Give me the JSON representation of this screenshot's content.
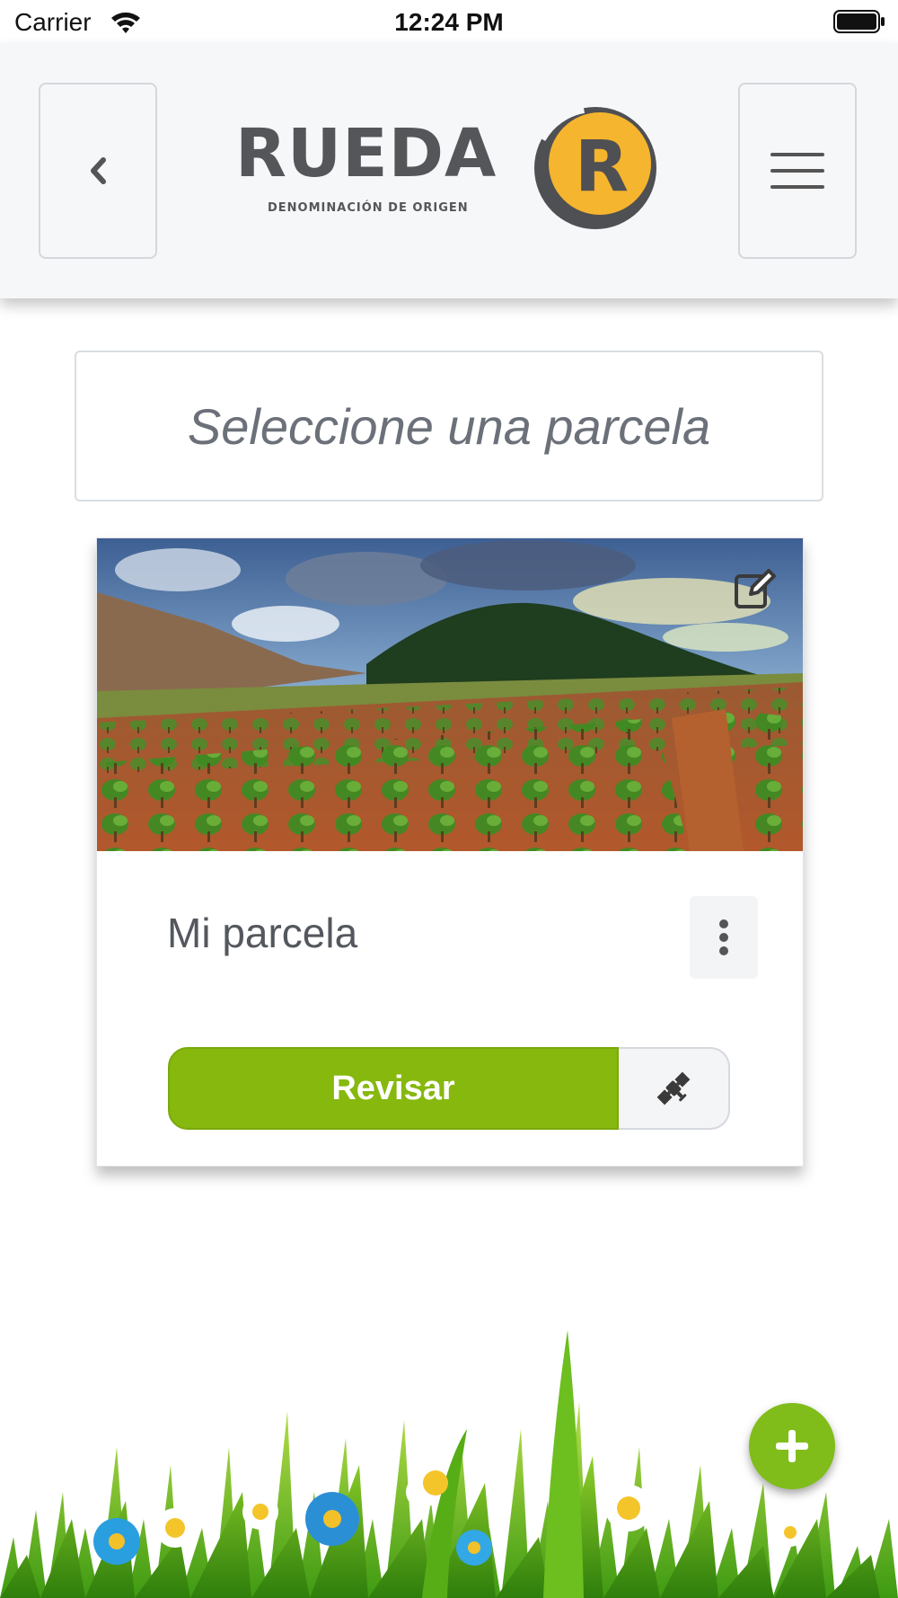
{
  "status_bar": {
    "carrier": "Carrier",
    "time": "12:24 PM",
    "wifi_icon": "wifi-icon",
    "battery_icon": "battery-full-icon"
  },
  "header": {
    "back_icon": "chevron-left-icon",
    "menu_icon": "hamburger-menu-icon",
    "logo": {
      "wordmark": "RUEDA",
      "tagline": "DENOMINACIÓN DE ORIGEN",
      "mark_letter": "R",
      "colors": {
        "text": "#555659",
        "mark_ring": "#4f5054",
        "mark_fill": "#f6b52e"
      }
    }
  },
  "page": {
    "title": "Seleccione una parcela"
  },
  "parcel_card": {
    "name": "Mi parcela",
    "edit_icon": "edit-icon",
    "options_icon": "vertical-dots-icon",
    "review_button": "Revisar",
    "satellite_icon": "satellite-icon"
  },
  "fab": {
    "icon": "plus-icon"
  },
  "colors": {
    "primary_green": "#86b80e",
    "fab_green": "#80bd1a",
    "title_gray": "#6b7079",
    "header_bg": "#f6f7f9"
  }
}
